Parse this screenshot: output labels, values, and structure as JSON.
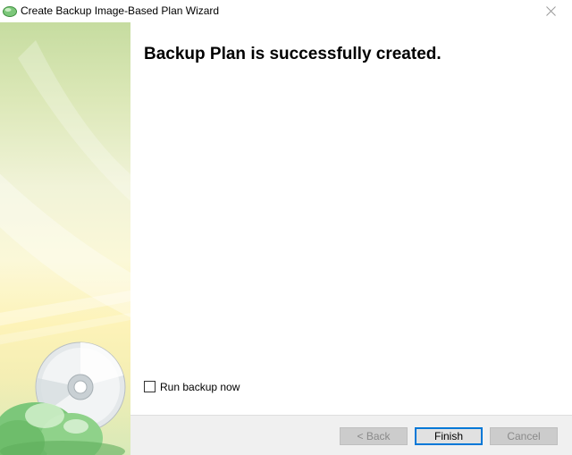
{
  "window": {
    "title": "Create Backup Image-Based Plan Wizard",
    "app_icon": "green-cloud-icon",
    "close_icon": "close-icon"
  },
  "main": {
    "heading": "Backup Plan is successfully created."
  },
  "options": {
    "run_backup_now": {
      "label": "Run backup now",
      "checked": false
    }
  },
  "buttons": {
    "back_label": "< Back",
    "back_enabled": false,
    "finish_label": "Finish",
    "cancel_label": "Cancel",
    "cancel_enabled": false
  },
  "colors": {
    "accent": "#0078d7",
    "side_panel_top": "#c6dca0",
    "side_panel_mid": "#fdf3b8"
  }
}
